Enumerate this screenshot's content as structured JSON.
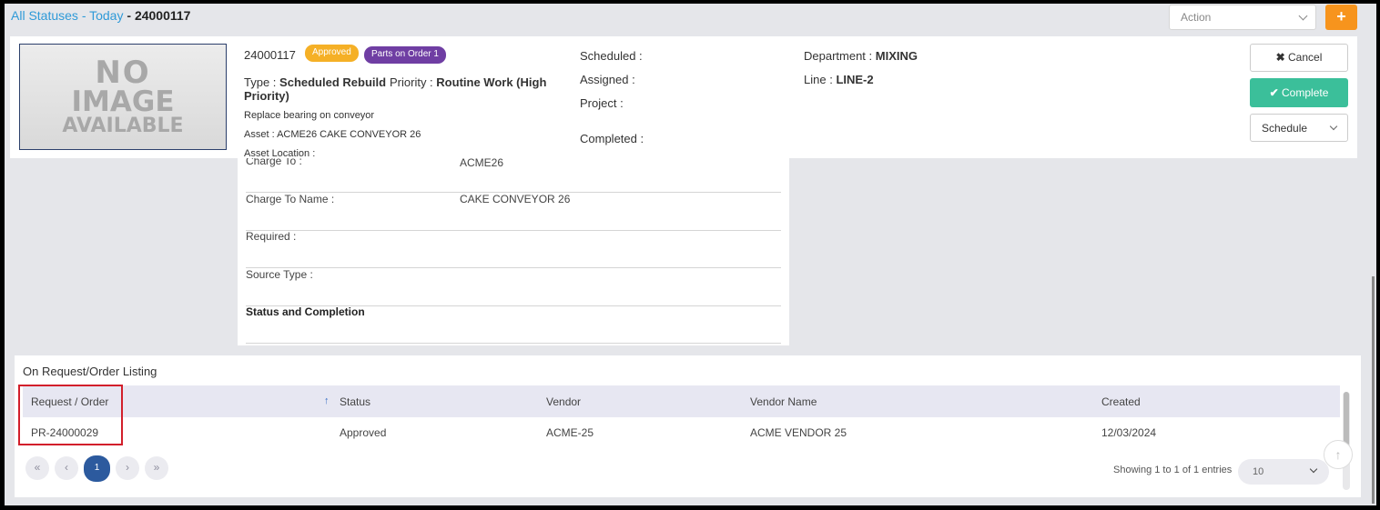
{
  "breadcrumb": {
    "link": "All Statuses - Today",
    "sep": " - ",
    "current": "24000117"
  },
  "toolbar": {
    "action_placeholder": "Action",
    "add_label": "+"
  },
  "work_order": {
    "image_text": [
      "NO",
      "IMAGE",
      "AVAILABLE"
    ],
    "number": "24000117",
    "status_badge": "Approved",
    "parts_badge": "Parts on Order 1",
    "type_label": "Type :",
    "type_value": "Scheduled Rebuild",
    "priority_label": "Priority :",
    "priority_value_1": "Routine Work (High",
    "priority_value_2": "Priority)",
    "description": "Replace bearing on conveyor",
    "asset": "Asset : ACME26 CAKE CONVEYOR 26",
    "asset_location": "Asset Location :",
    "scheduled_label": "Scheduled :",
    "assigned_label": "Assigned :",
    "project_label": "Project :",
    "completed_label": "Completed :",
    "department_label": "Department :",
    "department_value": "MIXING",
    "line_label": "Line :",
    "line_value": "LINE-2"
  },
  "buttons": {
    "cancel": "Cancel",
    "complete": "Complete",
    "schedule": "Schedule"
  },
  "details": [
    {
      "key": "Charge To :",
      "value": "ACME26"
    },
    {
      "key": "Charge To Name :",
      "value": "CAKE CONVEYOR 26"
    },
    {
      "key": "Required :",
      "value": ""
    },
    {
      "key": "Source Type :",
      "value": ""
    },
    {
      "key": "Status and Completion",
      "value": ""
    }
  ],
  "listing": {
    "title": "On Request/Order Listing",
    "columns": [
      "Request / Order",
      "Status",
      "Vendor",
      "Vendor Name",
      "Created"
    ],
    "rows": [
      [
        "PR-24000029",
        "Approved",
        "ACME-25",
        "ACME VENDOR 25",
        "12/03/2024"
      ]
    ],
    "page": "1",
    "showing": "Showing 1 to 1 of 1 entries",
    "page_length": "10"
  },
  "colors": {
    "link": "#2f9ad8",
    "add_button": "#f7941d",
    "approved_badge": "#f5b026",
    "parts_badge": "#6f3ea3",
    "complete_button": "#3bbf9a",
    "active_page": "#2c5a9e",
    "highlight": "#d21f2b"
  },
  "icons": {
    "cancel": "times-icon",
    "complete": "check-icon",
    "sort": "arrow-up-icon",
    "to_top": "arrow-up-icon"
  }
}
